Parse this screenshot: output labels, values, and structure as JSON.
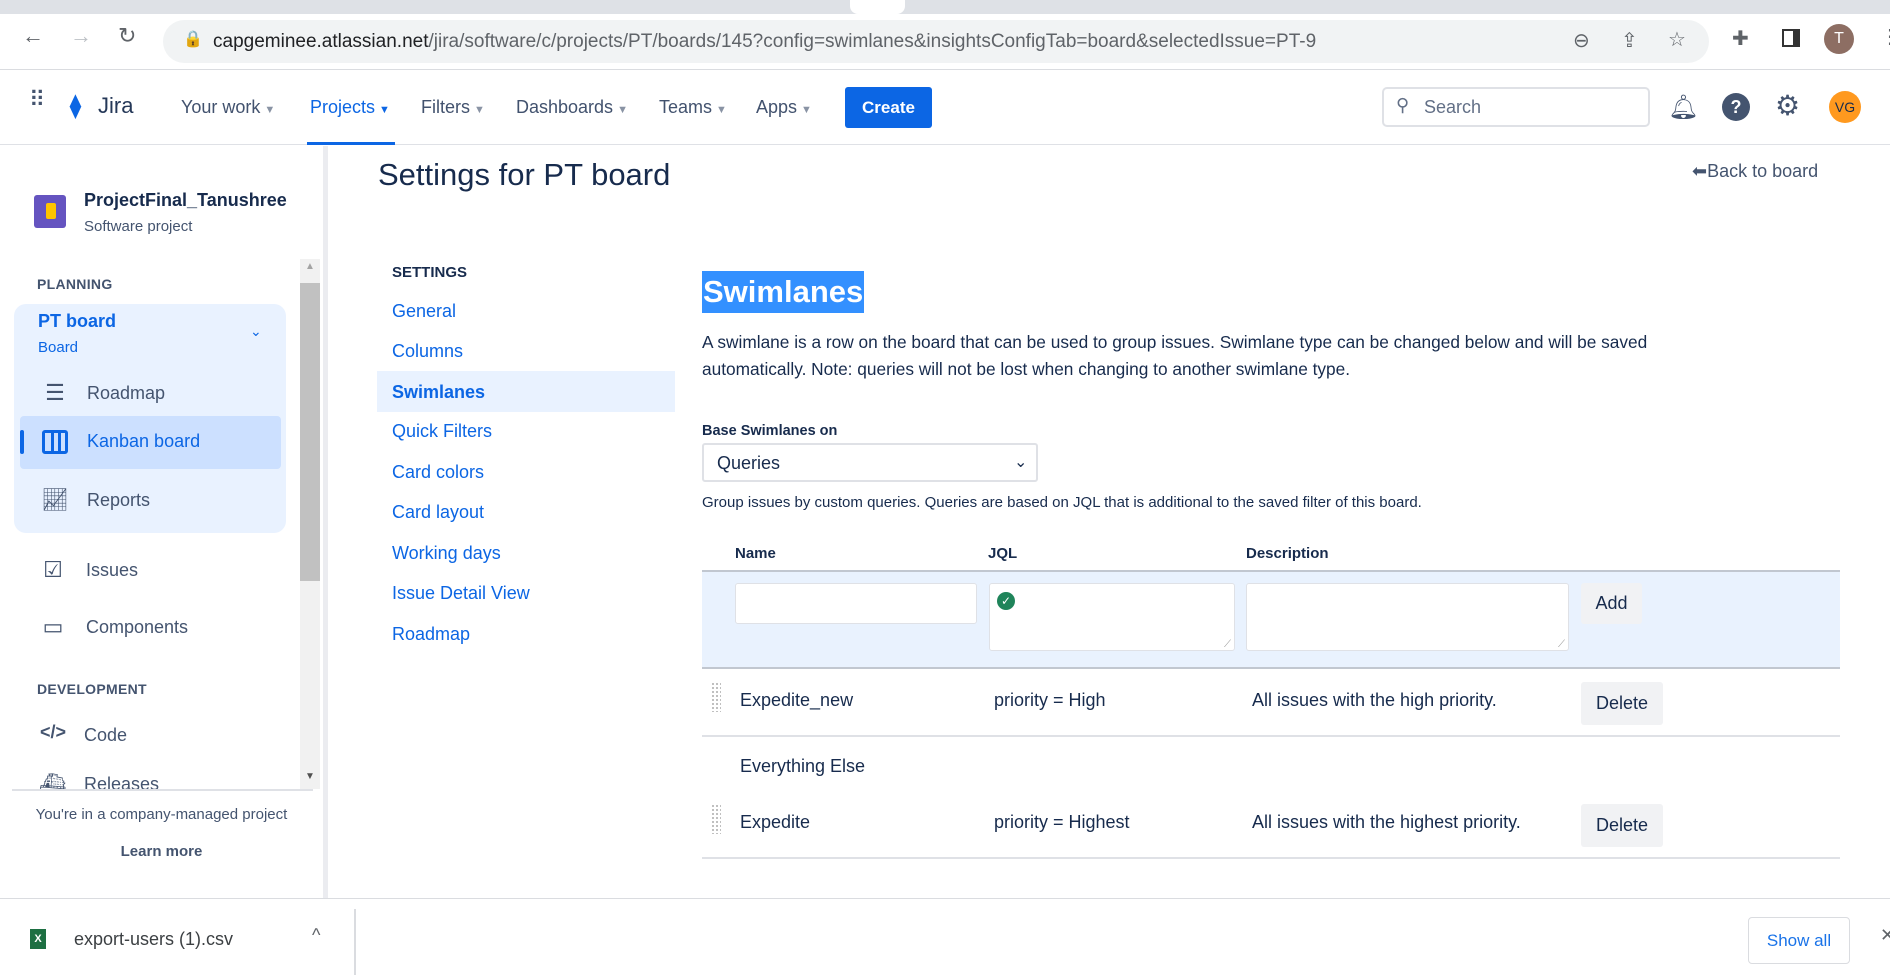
{
  "browser": {
    "url_host": "capgeminee.atlassian.net",
    "url_path": "/jira/software/c/projects/PT/boards/145?config=swimlanes&insightsConfigTab=board&selectedIssue=PT-9",
    "profile_initial": "T"
  },
  "topnav": {
    "product": "Jira",
    "items": [
      "Your work",
      "Projects",
      "Filters",
      "Dashboards",
      "Teams",
      "Apps"
    ],
    "active": "Projects",
    "create_label": "Create",
    "search_placeholder": "Search",
    "avatar_initials": "VG"
  },
  "sidebar": {
    "project_name": "ProjectFinal_Tanushree",
    "project_type": "Software project",
    "planning_label": "PLANNING",
    "board_name": "PT board",
    "board_sub": "Board",
    "planning_items": [
      "Roadmap",
      "Kanban board",
      "Reports"
    ],
    "other_items": [
      "Issues",
      "Components"
    ],
    "development_label": "DEVELOPMENT",
    "dev_items": [
      "Code",
      "Releases"
    ],
    "footer_text": "You're in a company-managed project",
    "learn_more": "Learn more"
  },
  "page": {
    "title": "Settings for PT board",
    "back_link": "Back to board",
    "settings_label": "SETTINGS",
    "settings_nav": [
      "General",
      "Columns",
      "Swimlanes",
      "Quick Filters",
      "Card colors",
      "Card layout",
      "Working days",
      "Issue Detail View",
      "Roadmap"
    ],
    "active_nav": "Swimlanes"
  },
  "swimlanes": {
    "heading": "Swimlanes",
    "description_line1": "A swimlane is a row on the board that can be used to group issues. Swimlane type can be changed below and will be saved",
    "description_line2": "automatically. Note: queries will not be lost when changing to another swimlane type.",
    "base_label": "Base Swimlanes on",
    "base_value": "Queries",
    "help_text": "Group issues by custom queries. Queries are based on JQL that is additional to the saved filter of this board.",
    "columns": [
      "Name",
      "JQL",
      "Description"
    ],
    "add_label": "Add",
    "rows": [
      {
        "name": "Expedite_new",
        "jql": "priority = High",
        "description": "All issues with the high priority.",
        "action": "Delete"
      },
      {
        "name": "Expedite",
        "jql": "priority = Highest",
        "description": "All issues with the highest priority.",
        "action": "Delete"
      }
    ],
    "default_lane": "Everything Else"
  },
  "downloads": {
    "file_name": "export-users (1).csv",
    "show_all": "Show all"
  }
}
